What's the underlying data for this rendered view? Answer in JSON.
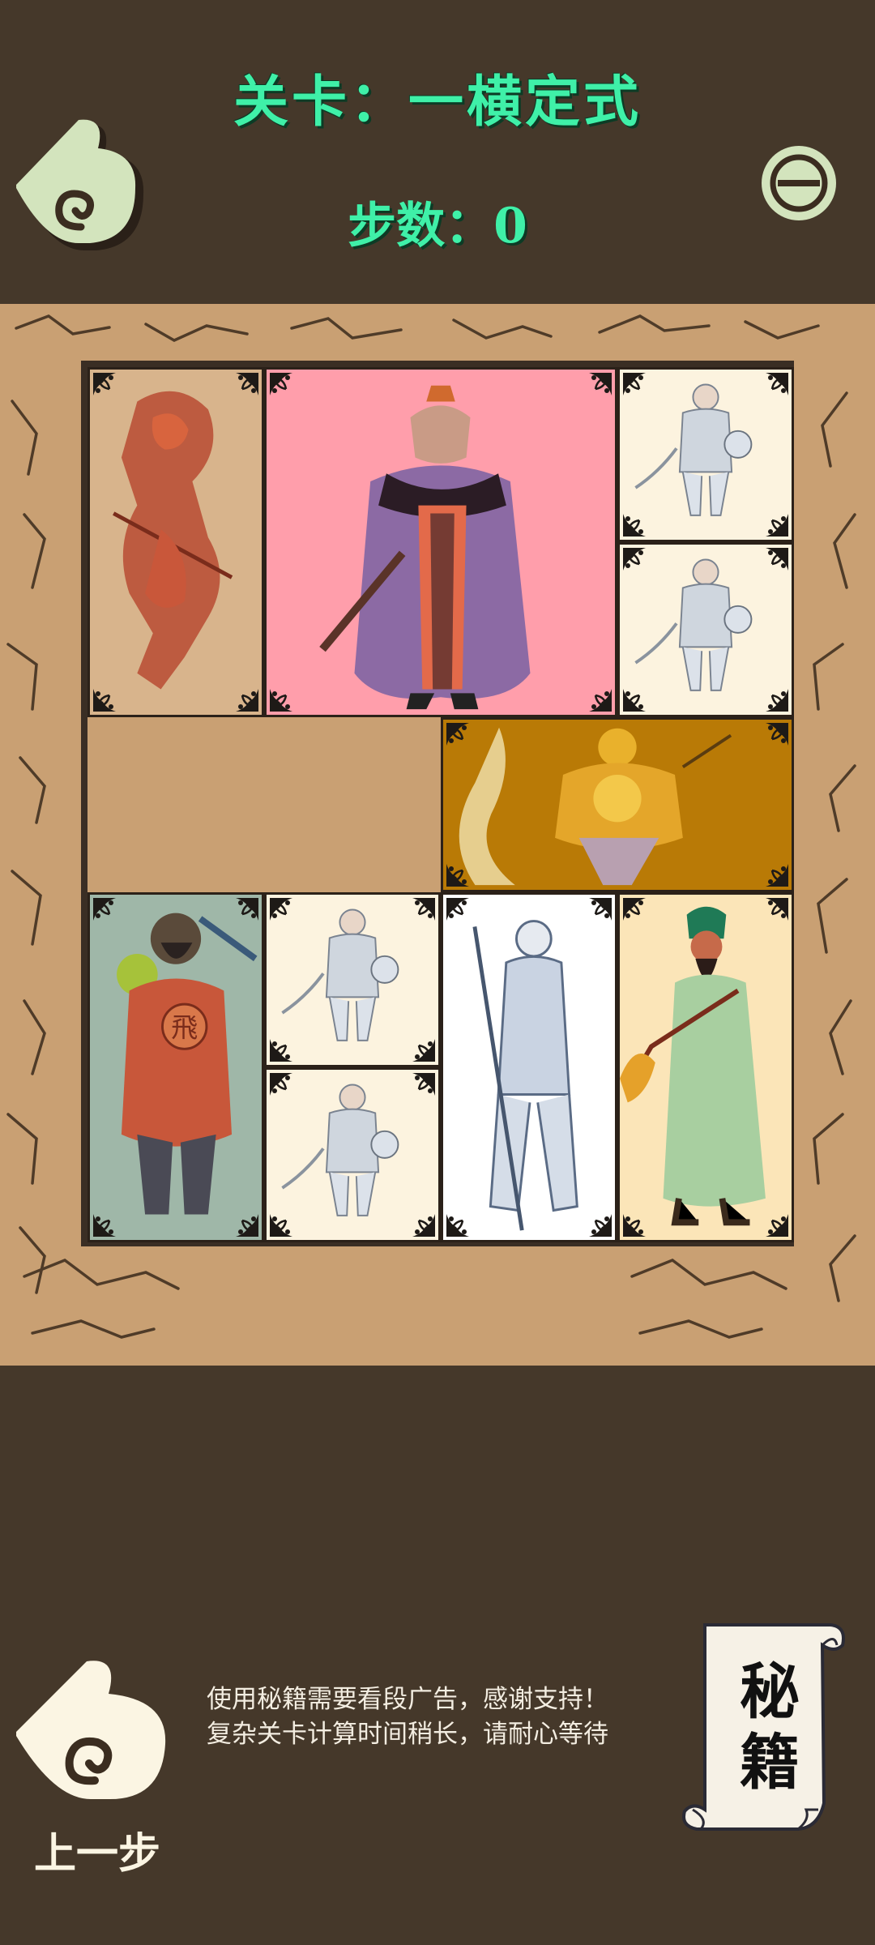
{
  "header": {
    "level_title": "关卡：一横定式",
    "step_counter": "步数：0",
    "back_icon": "cloud-swirl-back-icon",
    "menu_icon": "circle-menu-icon"
  },
  "board": {
    "pieces": [
      {
        "id": "red-warrior",
        "kind": "tall"
      },
      {
        "id": "cao-cao",
        "kind": "big"
      },
      {
        "id": "soldier",
        "kind": "small"
      },
      {
        "id": "soldier",
        "kind": "small"
      },
      {
        "id": "golden-general",
        "kind": "wide"
      },
      {
        "id": "zhang-fei",
        "kind": "tall",
        "emblem": "飛"
      },
      {
        "id": "soldier",
        "kind": "small"
      },
      {
        "id": "soldier",
        "kind": "small"
      },
      {
        "id": "zhao-yun",
        "kind": "tall"
      },
      {
        "id": "guan-yu",
        "kind": "tall"
      }
    ]
  },
  "footer": {
    "undo_label": "上一步",
    "undo_icon": "cloud-swirl-undo-icon",
    "notice_line1": "使用秘籍需要看段广告，感谢支持！",
    "notice_line2": "复杂关卡计算时间稍长，请耐心等待",
    "cheat_char1": "秘",
    "cheat_char2": "籍",
    "cheat_icon": "scroll-icon"
  },
  "colors": {
    "background": "#45382a",
    "title": "#3ff0a8",
    "board": "#c9a073",
    "cream": "#fbf5e3"
  }
}
